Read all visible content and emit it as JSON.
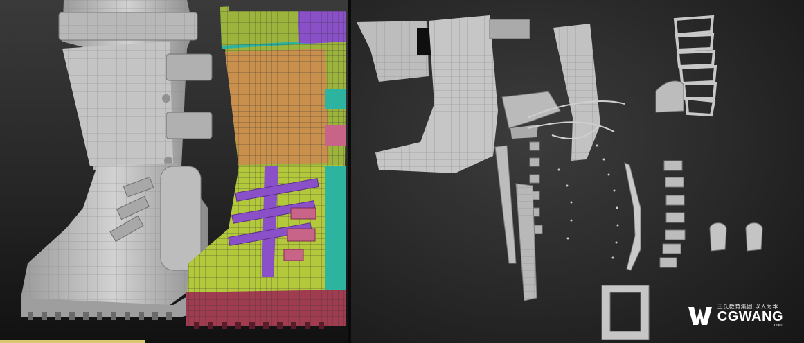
{
  "watermark": {
    "cn_text": "王氏教育集团,以人为本",
    "en_text": "CGWANG",
    "suffix": ".com",
    "logo": "cgwang-logo"
  },
  "colors": {
    "mesh_gray": "#c8c8c8",
    "uv_green": "#9cb43c",
    "uv_orange": "#c8904c",
    "uv_purple": "#8a50c8",
    "uv_teal": "#2cb4a0",
    "uv_red": "#a03c50",
    "uv_pink": "#c86488"
  }
}
